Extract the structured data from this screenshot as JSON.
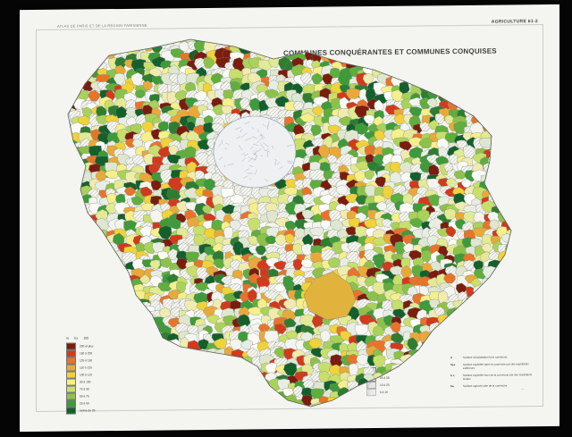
{
  "sheet": {
    "atlas_label": "ATLAS DE PARIS ET DE LA RÉGION PARISIENNE",
    "sheet_code": "AGRICULTURE 61-2",
    "title": "COMMUNES CONQUÉRANTES ET COMMUNES CONQUISES"
  },
  "legend_gain": {
    "headers": [
      "%",
      "Ex",
      "100"
    ],
    "classes": [
      {
        "color": "#7a1d0f",
        "label": "200 et plus"
      },
      {
        "color": "#d23a1d",
        "label": "150 à 200"
      },
      {
        "color": "#e8742a",
        "label": "125 à 150"
      },
      {
        "color": "#e9a93a",
        "label": "110 à 125"
      },
      {
        "color": "#f0d23a",
        "label": "100 à 110"
      },
      {
        "color": "#f5ef8c",
        "label": "90 à 100"
      },
      {
        "color": "#c8df6b",
        "label": "75 à 90"
      },
      {
        "color": "#8cc24a",
        "label": "50 à 75"
      },
      {
        "color": "#3f9a3a",
        "label": "25 à 50"
      },
      {
        "color": "#14602c",
        "label": "moins de 25"
      }
    ]
  },
  "legend_loss": {
    "headers": [
      "Ca",
      "100"
    ],
    "classes": [
      {
        "label": "50 à 100"
      },
      {
        "label": "25 à 50"
      },
      {
        "label": "10 à 25"
      },
      {
        "label": "0 à 10"
      }
    ]
  },
  "notes": [
    {
      "key": "A",
      "text": "Surface d'exploitation hors commune"
    },
    {
      "key": "Sex",
      "text": "Surface exploitée dans la commune par des exploitants extérieurs"
    },
    {
      "key": "A x",
      "text": "Surface exploitée hors de la commune par des exploitants locaux"
    },
    {
      "key": "Sa",
      "text": "Surface agricole utile de la commune"
    }
  ],
  "map": {
    "palette": [
      "#14602c",
      "#2e7d32",
      "#3f9a3a",
      "#5fae3e",
      "#8cc24a",
      "#a9d25a",
      "#c8df6b",
      "#e2ea96",
      "#f0ecb0",
      "#f5ef8c",
      "#f0d23a",
      "#e9a93a",
      "#e8742a",
      "#d23a1d",
      "#7a1d0f",
      "#e8ede4",
      "#f4f5f1",
      "#fbfbf7",
      "#dfe7d0"
    ],
    "paris_fill": "#eef0f2",
    "paris_stroke": "#8894a6",
    "highlight_color": "#e1b33c"
  }
}
